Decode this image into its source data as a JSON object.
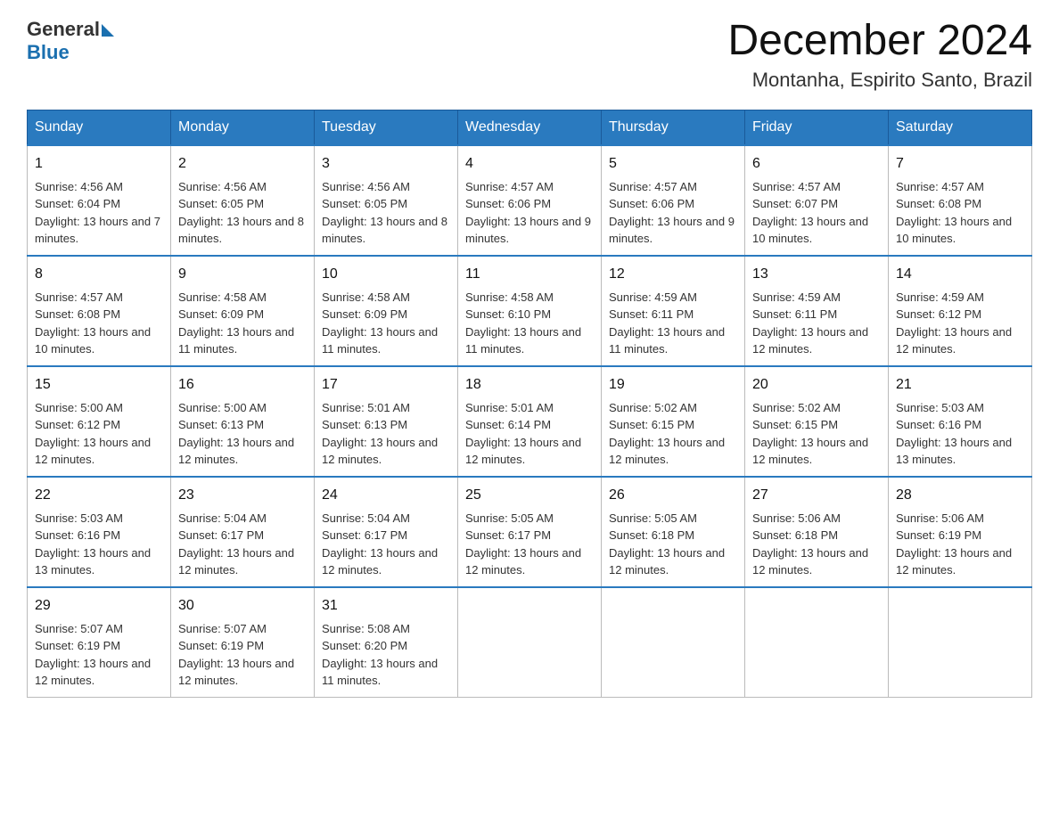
{
  "header": {
    "logo_general": "General",
    "logo_blue": "Blue",
    "month_title": "December 2024",
    "location": "Montanha, Espirito Santo, Brazil"
  },
  "days_of_week": [
    "Sunday",
    "Monday",
    "Tuesday",
    "Wednesday",
    "Thursday",
    "Friday",
    "Saturday"
  ],
  "weeks": [
    [
      {
        "day": "1",
        "sunrise": "4:56 AM",
        "sunset": "6:04 PM",
        "daylight": "13 hours and 7 minutes."
      },
      {
        "day": "2",
        "sunrise": "4:56 AM",
        "sunset": "6:05 PM",
        "daylight": "13 hours and 8 minutes."
      },
      {
        "day": "3",
        "sunrise": "4:56 AM",
        "sunset": "6:05 PM",
        "daylight": "13 hours and 8 minutes."
      },
      {
        "day": "4",
        "sunrise": "4:57 AM",
        "sunset": "6:06 PM",
        "daylight": "13 hours and 9 minutes."
      },
      {
        "day": "5",
        "sunrise": "4:57 AM",
        "sunset": "6:06 PM",
        "daylight": "13 hours and 9 minutes."
      },
      {
        "day": "6",
        "sunrise": "4:57 AM",
        "sunset": "6:07 PM",
        "daylight": "13 hours and 10 minutes."
      },
      {
        "day": "7",
        "sunrise": "4:57 AM",
        "sunset": "6:08 PM",
        "daylight": "13 hours and 10 minutes."
      }
    ],
    [
      {
        "day": "8",
        "sunrise": "4:57 AM",
        "sunset": "6:08 PM",
        "daylight": "13 hours and 10 minutes."
      },
      {
        "day": "9",
        "sunrise": "4:58 AM",
        "sunset": "6:09 PM",
        "daylight": "13 hours and 11 minutes."
      },
      {
        "day": "10",
        "sunrise": "4:58 AM",
        "sunset": "6:09 PM",
        "daylight": "13 hours and 11 minutes."
      },
      {
        "day": "11",
        "sunrise": "4:58 AM",
        "sunset": "6:10 PM",
        "daylight": "13 hours and 11 minutes."
      },
      {
        "day": "12",
        "sunrise": "4:59 AM",
        "sunset": "6:11 PM",
        "daylight": "13 hours and 11 minutes."
      },
      {
        "day": "13",
        "sunrise": "4:59 AM",
        "sunset": "6:11 PM",
        "daylight": "13 hours and 12 minutes."
      },
      {
        "day": "14",
        "sunrise": "4:59 AM",
        "sunset": "6:12 PM",
        "daylight": "13 hours and 12 minutes."
      }
    ],
    [
      {
        "day": "15",
        "sunrise": "5:00 AM",
        "sunset": "6:12 PM",
        "daylight": "13 hours and 12 minutes."
      },
      {
        "day": "16",
        "sunrise": "5:00 AM",
        "sunset": "6:13 PM",
        "daylight": "13 hours and 12 minutes."
      },
      {
        "day": "17",
        "sunrise": "5:01 AM",
        "sunset": "6:13 PM",
        "daylight": "13 hours and 12 minutes."
      },
      {
        "day": "18",
        "sunrise": "5:01 AM",
        "sunset": "6:14 PM",
        "daylight": "13 hours and 12 minutes."
      },
      {
        "day": "19",
        "sunrise": "5:02 AM",
        "sunset": "6:15 PM",
        "daylight": "13 hours and 12 minutes."
      },
      {
        "day": "20",
        "sunrise": "5:02 AM",
        "sunset": "6:15 PM",
        "daylight": "13 hours and 12 minutes."
      },
      {
        "day": "21",
        "sunrise": "5:03 AM",
        "sunset": "6:16 PM",
        "daylight": "13 hours and 13 minutes."
      }
    ],
    [
      {
        "day": "22",
        "sunrise": "5:03 AM",
        "sunset": "6:16 PM",
        "daylight": "13 hours and 13 minutes."
      },
      {
        "day": "23",
        "sunrise": "5:04 AM",
        "sunset": "6:17 PM",
        "daylight": "13 hours and 12 minutes."
      },
      {
        "day": "24",
        "sunrise": "5:04 AM",
        "sunset": "6:17 PM",
        "daylight": "13 hours and 12 minutes."
      },
      {
        "day": "25",
        "sunrise": "5:05 AM",
        "sunset": "6:17 PM",
        "daylight": "13 hours and 12 minutes."
      },
      {
        "day": "26",
        "sunrise": "5:05 AM",
        "sunset": "6:18 PM",
        "daylight": "13 hours and 12 minutes."
      },
      {
        "day": "27",
        "sunrise": "5:06 AM",
        "sunset": "6:18 PM",
        "daylight": "13 hours and 12 minutes."
      },
      {
        "day": "28",
        "sunrise": "5:06 AM",
        "sunset": "6:19 PM",
        "daylight": "13 hours and 12 minutes."
      }
    ],
    [
      {
        "day": "29",
        "sunrise": "5:07 AM",
        "sunset": "6:19 PM",
        "daylight": "13 hours and 12 minutes."
      },
      {
        "day": "30",
        "sunrise": "5:07 AM",
        "sunset": "6:19 PM",
        "daylight": "13 hours and 12 minutes."
      },
      {
        "day": "31",
        "sunrise": "5:08 AM",
        "sunset": "6:20 PM",
        "daylight": "13 hours and 11 minutes."
      },
      null,
      null,
      null,
      null
    ]
  ]
}
